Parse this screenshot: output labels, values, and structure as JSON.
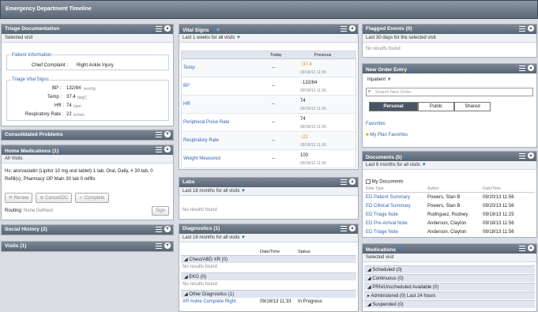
{
  "app_title": "Emergency Department Timeline",
  "triage": {
    "title": "Triage Documentation",
    "sub": "Selected visit",
    "pi_label": "Patient Information",
    "cc_label": "Chief Complaint :",
    "cc_value": "Right Ankle Injury",
    "tv_label": "Triage Vital Signs",
    "bp_l": "BP :",
    "bp_v": "132/84",
    "bp_u": "mmHg",
    "temp_l": "Temp :",
    "temp_v": "37.4",
    "temp_u": "degC",
    "hr_l": "HR :",
    "hr_v": "74",
    "hr_u": "bpm",
    "rr_l": "Respiratory Rate :",
    "rr_v": "22",
    "rr_u": "br/min"
  },
  "consolidated": {
    "title": "Consolidated Problems"
  },
  "homemeds": {
    "title": "Home Medications (1)",
    "sub": "All Visits",
    "med_line1": "Hx: atorvastatin (Lipitor 10 mg oral tablet) 1 tab, Oral, Daily, # 30 tab, 0",
    "med_line2": "Refill(s), Pharmacy OP Main 30 tab 0 refills",
    "renew": "Renew",
    "cancel": "Cancel/DC",
    "complete": "Complete",
    "routing_l": "Routing:",
    "routing_v": "None Defined",
    "sign": "Sign"
  },
  "social": {
    "title": "Social History (2)"
  },
  "visits": {
    "title": "Visits (1)"
  },
  "vitals": {
    "title": "Vital Signs",
    "sub": "Last 1 weeks for all visits",
    "col_today": "Today",
    "col_prev": "Previous",
    "rows": [
      {
        "name": "Temp",
        "today": "--",
        "prev": "37.4",
        "date": "09/18/13 11:56"
      },
      {
        "name": "BP",
        "today": "--",
        "prev": "132/84",
        "date": "09/18/13 11:56"
      },
      {
        "name": "HR",
        "today": "--",
        "prev": "74",
        "date": "09/18/13 11:56"
      },
      {
        "name": "Peripheral Pulse Rate",
        "today": "--",
        "prev": "74",
        "date": "09/18/13 11:56"
      },
      {
        "name": "Respiratory Rate",
        "today": "--",
        "prev": "22",
        "date": "09/18/13 11:56"
      },
      {
        "name": "Weight Measured",
        "today": "--",
        "prev": "100",
        "date": "09/18/13 11:56"
      }
    ]
  },
  "labs": {
    "title": "Labs",
    "sub": "Last 18 months for all visits",
    "empty": "No results found"
  },
  "diagnostics": {
    "title": "Diagnostics (1)",
    "sub": "Last 18 months for all visits",
    "col_dt": "Date/Time",
    "col_status": "Status",
    "g1": "Chest/ABD XR (0)",
    "g1_empty": "No results found",
    "g2": "EKG (0)",
    "g2_empty": "No results found",
    "g3": "Other Diagnostics (1)",
    "item": "XR Ankle Complete Right",
    "item_dt": "09/18/13 11:33",
    "item_status": "In Progress"
  },
  "flagged": {
    "title": "Flagged Events (0)",
    "sub": "Last 30 days for the selected visit",
    "empty": "No results found"
  },
  "neworder": {
    "title": "New Order Entry",
    "inpatient": "Inpatient",
    "search_ph": "Search New Order",
    "tab_personal": "Personal",
    "tab_public": "Public",
    "tab_shared": "Shared",
    "favorites": "Favorites",
    "myplan": "My Plan Favorites"
  },
  "documents": {
    "title": "Documents (5)",
    "sub": "Last 6 months for all visits",
    "mydocs": "My Documents",
    "col_type": "Note Type",
    "col_author": "Author",
    "col_dt": "Date/Time",
    "rows": [
      {
        "type": "ED Patient Summary",
        "author": "Powers, Stan B",
        "dt": "09/20/13 11:56"
      },
      {
        "type": "ED Clinical Summary",
        "author": "Powers, Stan B",
        "dt": "09/20/13 11:56"
      },
      {
        "type": "ED Triage Note",
        "author": "Rodriguez, Rodney",
        "dt": "09/19/13 11:25"
      },
      {
        "type": "ED Pre-Arrival Note",
        "author": "Anderson, Clayton",
        "dt": "09/18/13 11:56"
      },
      {
        "type": "ED Triage Note",
        "author": "Anderson, Clayton",
        "dt": "09/18/13 11:56"
      }
    ]
  },
  "medications": {
    "title": "Medications",
    "sub": "Selected visit",
    "g1": "Scheduled (0)",
    "g2": "Continuous (0)",
    "g3": "PRN/Unscheduled Available (0)",
    "g4": "Administered (0) Last 24 hours",
    "g5": "Suspended (0)"
  }
}
